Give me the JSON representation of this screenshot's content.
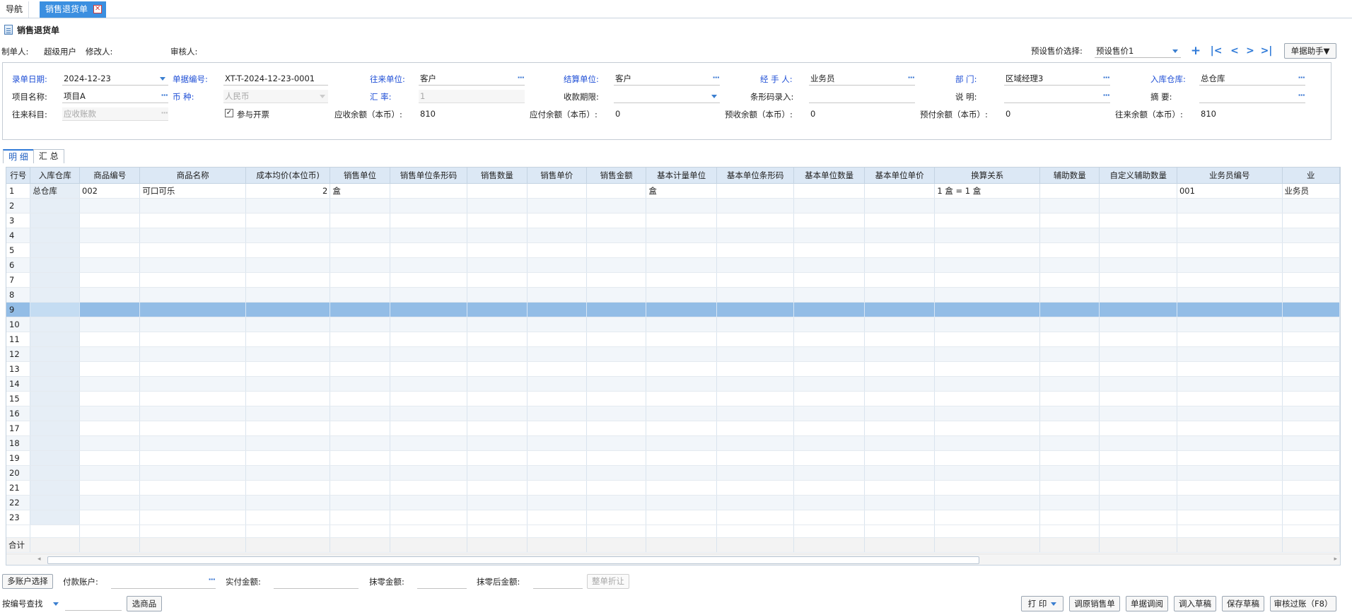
{
  "tabs": {
    "nav": "导航",
    "active": "销售退货单",
    "close_glyph": "✕"
  },
  "page": {
    "title": "销售退货单",
    "icon": "document-icon"
  },
  "meta": {
    "maker_label": "制单人:",
    "maker": "超级用户",
    "modifier_label": "修改人:",
    "auditor_label": "审核人:"
  },
  "price_select": {
    "label": "预设售价选择:",
    "value": "预设售价1"
  },
  "nav_buttons": {
    "add": "+",
    "first": "|<",
    "prev": "<",
    "next": ">",
    "last": ">|"
  },
  "helper_button": "单据助手▼",
  "form": {
    "date_label": "录单日期:",
    "date": "2024-12-23",
    "docno_label": "单据编号:",
    "docno": "XT-T-2024-12-23-0001",
    "partner_label": "往来单位:",
    "partner": "客户",
    "settle_label": "结算单位:",
    "settle": "客户",
    "handler_label": "经 手 人:",
    "handler": "业务员",
    "dept_label": "部     门:",
    "dept": "区域经理3",
    "warehouse_label": "入库仓库:",
    "warehouse": "总仓库",
    "project_label": "项目名称:",
    "project": "项目A",
    "currency_label": "币     种:",
    "currency": "人民币",
    "rate_label": "汇     率:",
    "rate": "1",
    "term_label": "收款期限:",
    "term": "",
    "barcode_label": "条形码录入:",
    "barcode": "",
    "note_label": "说     明:",
    "note": "",
    "summary_label": "摘     要:",
    "summary": "",
    "account_label": "往来科目:",
    "account_placeholder": "应收账款",
    "invoice_label": "参与开票",
    "invoice_checked": "✓",
    "ar_label": "应收余额（本币）:",
    "ar": "810",
    "ap_label": "应付余额（本币）:",
    "ap": "0",
    "pre_recv_label": "预收余额（本币）:",
    "pre_recv": "0",
    "pre_pay_label": "预付余额（本币）:",
    "pre_pay": "0",
    "balance_label": "往来余额（本币）:",
    "balance": "810"
  },
  "subtabs": [
    "明 细",
    "汇 总"
  ],
  "grid": {
    "columns": [
      "行号",
      "入库仓库",
      "商品编号",
      "商品名称",
      "成本均价(本位币)",
      "销售单位",
      "销售单位条形码",
      "销售数量",
      "销售单价",
      "销售金额",
      "基本计量单位",
      "基本单位条形码",
      "基本单位数量",
      "基本单位单价",
      "换算关系",
      "辅助数量",
      "自定义辅助数量",
      "业务员编号",
      "业"
    ],
    "rows": [
      [
        "1",
        "总仓库",
        "002",
        "可口可乐",
        "2",
        "盒",
        "",
        "",
        "",
        "",
        "盒",
        "",
        "",
        "",
        "1 盒 = 1 盒",
        "",
        "",
        "001",
        "业务员"
      ],
      [
        "2"
      ],
      [
        "3"
      ],
      [
        "4"
      ],
      [
        "5"
      ],
      [
        "6"
      ],
      [
        "7"
      ],
      [
        "8"
      ],
      [
        "9"
      ],
      [
        "10"
      ],
      [
        "11"
      ],
      [
        "12"
      ],
      [
        "13"
      ],
      [
        "14"
      ],
      [
        "15"
      ],
      [
        "16"
      ],
      [
        "17"
      ],
      [
        "18"
      ],
      [
        "19"
      ],
      [
        "20"
      ],
      [
        "21"
      ],
      [
        "22"
      ],
      [
        "23"
      ]
    ],
    "selected_row": "9",
    "total_label": "合计"
  },
  "bottom": {
    "multi_account": "多账户选择",
    "pay_account_label": "付款账户:",
    "paid_label": "实付金额:",
    "rounding_label": "抹零金额:",
    "after_rounding_label": "抹零后金额:",
    "discount_button": "整单折让",
    "search_mode": "按编号查找",
    "select_goods": "选商品",
    "print": "打 印",
    "original_sale": "调原销售单",
    "doc_recall": "单据调阅",
    "load_draft": "调入草稿",
    "save_draft": "保存草稿",
    "post": "审核过账（F8）"
  }
}
